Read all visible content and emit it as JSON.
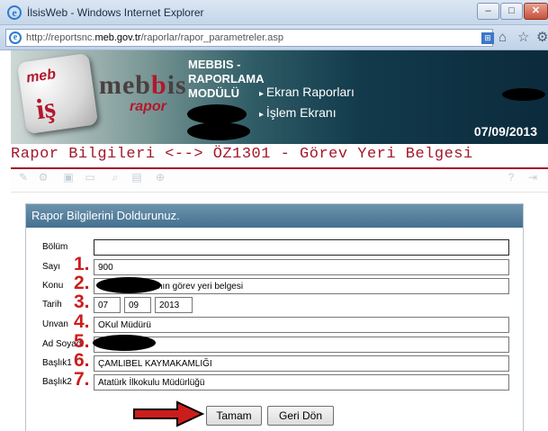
{
  "window": {
    "title": "İlsisWeb - Windows Internet Explorer",
    "minimize": "–",
    "maximize": "□",
    "close": "✕"
  },
  "address": {
    "url_prefix": "http://reportsnc.",
    "url_domain": "meb.gov.tr",
    "url_path": "/raporlar/rapor_parametreler.asp"
  },
  "banner": {
    "logo_top": "meb",
    "logo_bottom": "iş",
    "brand_a": "meb",
    "brand_b": "b",
    "brand_c": "is",
    "brand_sub": "rapor",
    "module_title_1": "MEBBIS -",
    "module_title_2": "RAPORLAMA",
    "module_title_3": "MODÜLÜ",
    "menu": [
      "Ekran Raporları",
      "İşlem Ekranı"
    ],
    "date": "07/09/2013"
  },
  "page_title": "Rapor Bilgileri <--> ÖZ1301 - Görev Yeri Belgesi",
  "form": {
    "heading": "Rapor Bilgilerini Doldurunuz.",
    "fields": [
      {
        "label": "Bölüm",
        "num": "",
        "value": ""
      },
      {
        "label": "Sayı",
        "num": "1.",
        "value": "900"
      },
      {
        "label": "Konu",
        "num": "2.",
        "value": "nın görev yeri belgesi"
      },
      {
        "label": "Tarih",
        "num": "3.",
        "day": "07",
        "month": "09",
        "year": "2013"
      },
      {
        "label": "Unvan",
        "num": "4.",
        "value": "OKul Müdürü"
      },
      {
        "label": "Ad Soyadı",
        "num": "5.",
        "value": ""
      },
      {
        "label": "Başlık1",
        "num": "6.",
        "value": "ÇAMLIBEL KAYMAKAMLIĞI"
      },
      {
        "label": "Başlık2",
        "num": "7.",
        "value": "Atatürk İlkokulu Müdürlüğü"
      }
    ],
    "ok_label": "Tamam",
    "back_label": "Geri Dön"
  },
  "colors": {
    "accent_red": "#a3172a",
    "number_red": "#cc1d1d",
    "panel_head": "#44708f"
  }
}
